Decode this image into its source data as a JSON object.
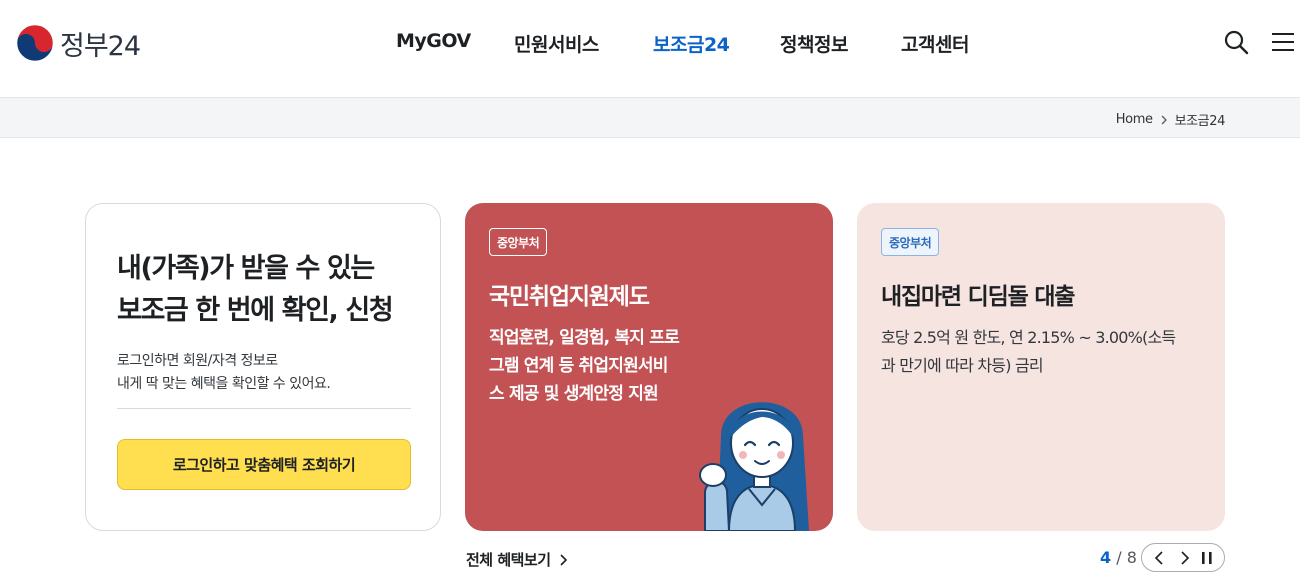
{
  "header": {
    "logo_text": "정부24",
    "nav": [
      {
        "label": "MyGOV",
        "active": false
      },
      {
        "label": "민원서비스",
        "active": false
      },
      {
        "label": "보조금24",
        "active": true
      },
      {
        "label": "정책정보",
        "active": false
      },
      {
        "label": "고객센터",
        "active": false
      }
    ],
    "icons": [
      "search-icon",
      "menu-icon"
    ]
  },
  "breadcrumb": {
    "home": "Home",
    "current": "보조금24"
  },
  "intro": {
    "title_line1": "내(가족)가 받을 수 있는",
    "title_line2": "보조금 한 번에 확인, 신청",
    "desc_line1": "로그인하면 회원/자격 정보로",
    "desc_line2": "내게 딱 맞는 혜택을 확인할 수 있어요.",
    "button_label": "로그인하고 맞춤혜택 조회하기"
  },
  "cards": [
    {
      "badge": "중앙부처",
      "title": "국민취업지원제도",
      "desc_lines": [
        "직업훈련, 일경험, 복지 프로",
        "그램 연계 등 취업지원서비",
        "스 제공 및 생계안정 지원"
      ],
      "bg_color": "#c25254"
    },
    {
      "badge": "중앙부처",
      "title": "내집마련 디딤돌 대출",
      "desc_lines": [
        "호당 2.5억 원 한도, 연 2.15% ~ 3.00%(소득",
        "과 만기에 따라 차등) 금리"
      ],
      "bg_color": "#f6e4e0"
    }
  ],
  "footer": {
    "more_label": "전체 혜택보기",
    "pager_current": "4",
    "pager_sep": "/",
    "pager_total": "8"
  },
  "colors": {
    "accent": "#0b63c8",
    "button_yellow": "#ffdf4f"
  }
}
